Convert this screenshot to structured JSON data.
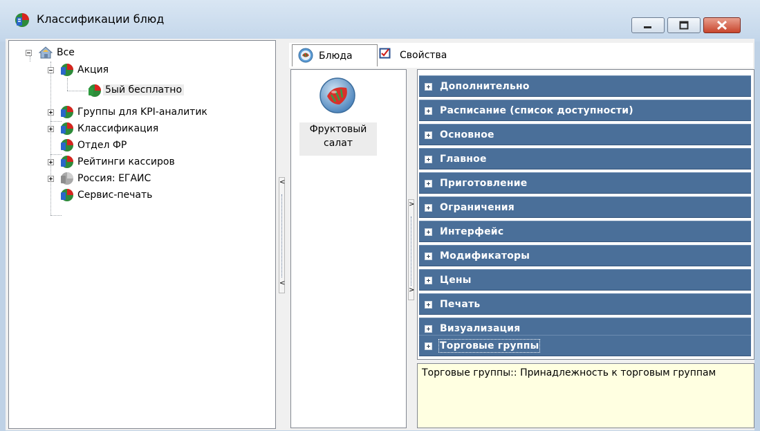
{
  "window": {
    "title": "Классификации блюд"
  },
  "tree": {
    "root": "Все",
    "items": [
      {
        "label": "Акция",
        "expanded": true
      },
      {
        "label": "5ый бесплатно",
        "selected": true
      },
      {
        "label": "Группы для KPI-аналитик",
        "expanded": false
      },
      {
        "label": "Классификация",
        "expanded": false
      },
      {
        "label": "Отдел ФР"
      },
      {
        "label": "Рейтинги кассиров",
        "expanded": false
      },
      {
        "label": "Россия: ЕГАИС",
        "expanded": false
      },
      {
        "label": "Сервис-печать"
      }
    ]
  },
  "tabs": {
    "dishes": "Блюда",
    "properties": "Свойства"
  },
  "dish": {
    "name": "Фруктовый салат"
  },
  "property_categories": [
    "Дополнительно",
    "Расписание (список доступности)",
    "Основное",
    "Главное",
    "Приготовление",
    "Ограничения",
    "Интерфейс",
    "Модификаторы",
    "Цены",
    "Печать",
    "Визуализация",
    "Торговые группы"
  ],
  "description": {
    "text": "Торговые группы:: Принадлежность к торговым группам"
  },
  "colors": {
    "category_bg": "#4a6f99",
    "description_bg": "#ffffe1"
  },
  "splitter": {
    "collapse_left": "<",
    "expand_right": ">"
  }
}
